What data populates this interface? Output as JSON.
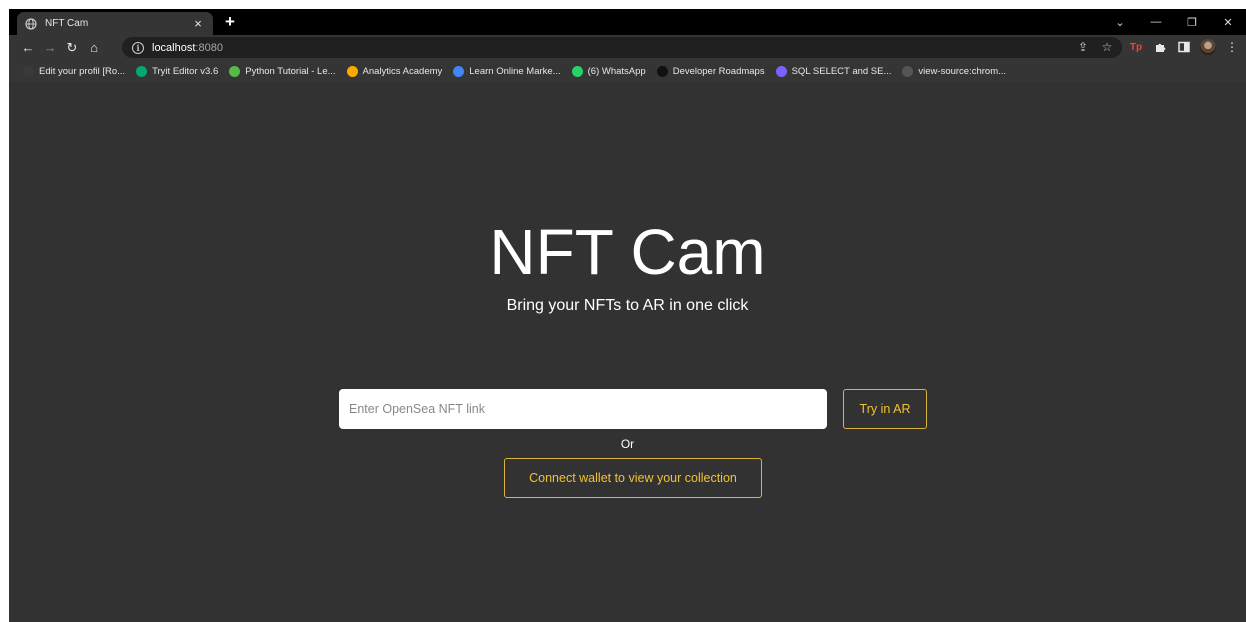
{
  "browser": {
    "tab": {
      "title": "NFT Cam",
      "favicon": "globe-icon",
      "close": "×"
    },
    "new_tab": "+",
    "window_controls": {
      "minimize": "—",
      "restore": "❐",
      "close": "✕",
      "dropdown": "⌄"
    },
    "nav": {
      "back": "←",
      "forward": "→",
      "reload": "↻",
      "home": "⌂"
    },
    "address": {
      "host": "localhost",
      "port": ":8080"
    },
    "bookmarks": [
      {
        "label": "Edit your profil [Ro...",
        "icon": "dot-icon",
        "color": "#3a3a3a"
      },
      {
        "label": "Tryit Editor v3.6",
        "icon": "w3-icon",
        "color": "#04aa6d"
      },
      {
        "label": "Python Tutorial - Le...",
        "icon": "python-icon",
        "color": "#58b947"
      },
      {
        "label": "Analytics Academy",
        "icon": "analytics-icon",
        "color": "#f9ab00"
      },
      {
        "label": "Learn Online Marke...",
        "icon": "google-icon",
        "color": "#4285f4"
      },
      {
        "label": "(6) WhatsApp",
        "icon": "whatsapp-icon",
        "color": "#25d366"
      },
      {
        "label": "Developer Roadmaps",
        "icon": "roadmap-icon",
        "color": "#111111"
      },
      {
        "label": "SQL SELECT and SE...",
        "icon": "sql-icon",
        "color": "#7b61ff"
      },
      {
        "label": "view-source:chrom...",
        "icon": "globe-icon",
        "color": "#555555"
      }
    ]
  },
  "page": {
    "title": "NFT Cam",
    "subtitle": "Bring your NFTs to AR in one click",
    "input_placeholder": "Enter OpenSea NFT link",
    "try_button": "Try in AR",
    "or_label": "Or",
    "connect_button": "Connect wallet to view your collection",
    "accent_color": "#f1c232"
  }
}
